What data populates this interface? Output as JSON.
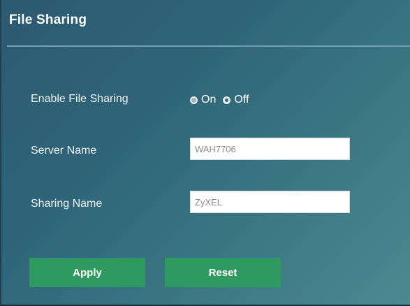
{
  "panel": {
    "title": "File Sharing"
  },
  "enable_file_sharing": {
    "label": "Enable File Sharing",
    "options": [
      {
        "label": "On",
        "selected": true
      },
      {
        "label": "Off",
        "selected": false
      }
    ]
  },
  "server_name": {
    "label": "Server Name",
    "value": "WAH7706"
  },
  "sharing_name": {
    "label": "Sharing Name",
    "value": "ZyXEL"
  },
  "buttons": {
    "apply": "Apply",
    "reset": "Reset"
  },
  "colors": {
    "panel_background": "#2f6478",
    "button": "#2f9a5f",
    "divider": "#6f9fb0"
  }
}
